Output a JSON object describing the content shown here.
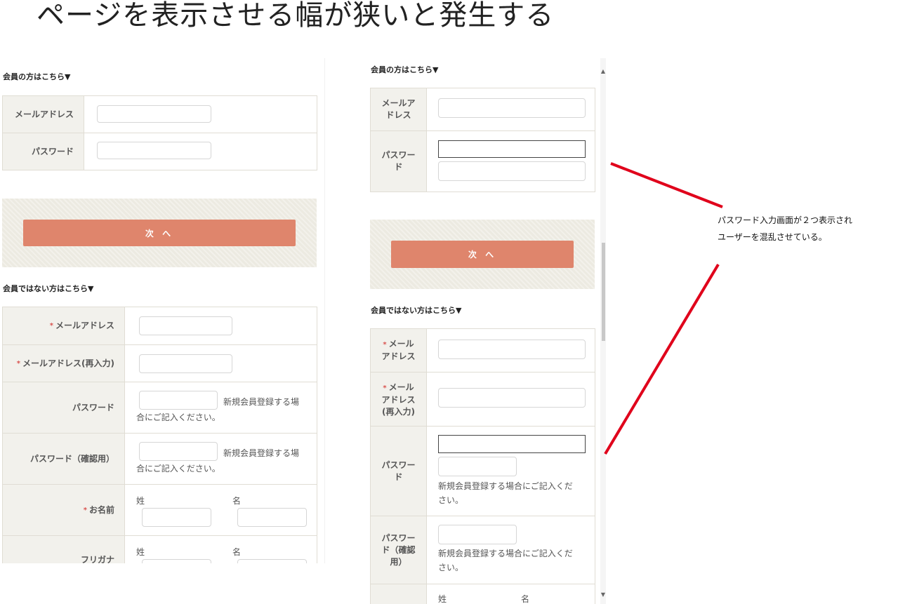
{
  "slide_title": "ページを表示させる幅が狭いと発生する",
  "annotation": {
    "line1": "パスワード入力画面が２つ表示され",
    "line2": "ユーザーを混乱させている。",
    "color": "#e0001b"
  },
  "left_panel": {
    "member_heading": "会員の方はこちら▼",
    "member_rows": [
      "メールアドレス",
      "パスワード"
    ],
    "next_button": "次 へ",
    "nonmember_heading": "会員ではない方はこちら▼",
    "nonmember_rows": {
      "email": "メールアドレス",
      "email_confirm": "メールアドレス(再入力)",
      "password": "パスワード",
      "password_confirm": "パスワード（確認用）",
      "name": "お名前",
      "furigana": "フリガナ"
    },
    "required_mark": "*",
    "password_note_a": "新規会員登録する場",
    "password_note_b": "合にご記入ください。",
    "last_name": "姓",
    "first_name": "名"
  },
  "right_panel": {
    "member_heading": "会員の方はこちら▼",
    "member_email_l1": "メールア",
    "member_email_l2": "ドレス",
    "member_pw_l1": "パスワー",
    "member_pw_l2": "ド",
    "next_button": "次 へ",
    "nonmember_heading": "会員ではない方はこちら▼",
    "email_l1": "メール",
    "email_l2": "アドレス",
    "emailc_l1": "メール",
    "emailc_l2": "アドレス",
    "emailc_l3": "(再入力)",
    "pw_l1": "パスワー",
    "pw_l2": "ド",
    "pwc_l1": "パスワー",
    "pwc_l2": "ド（確認",
    "pwc_l3": "用）",
    "password_note_a": "新規会員登録する場合にご記入くだ",
    "password_note_b": "さい。",
    "last_name": "姓",
    "first_name": "名"
  },
  "colors": {
    "button": "#df856c",
    "label_bg": "#f2f1ec",
    "required": "#d9534f"
  }
}
